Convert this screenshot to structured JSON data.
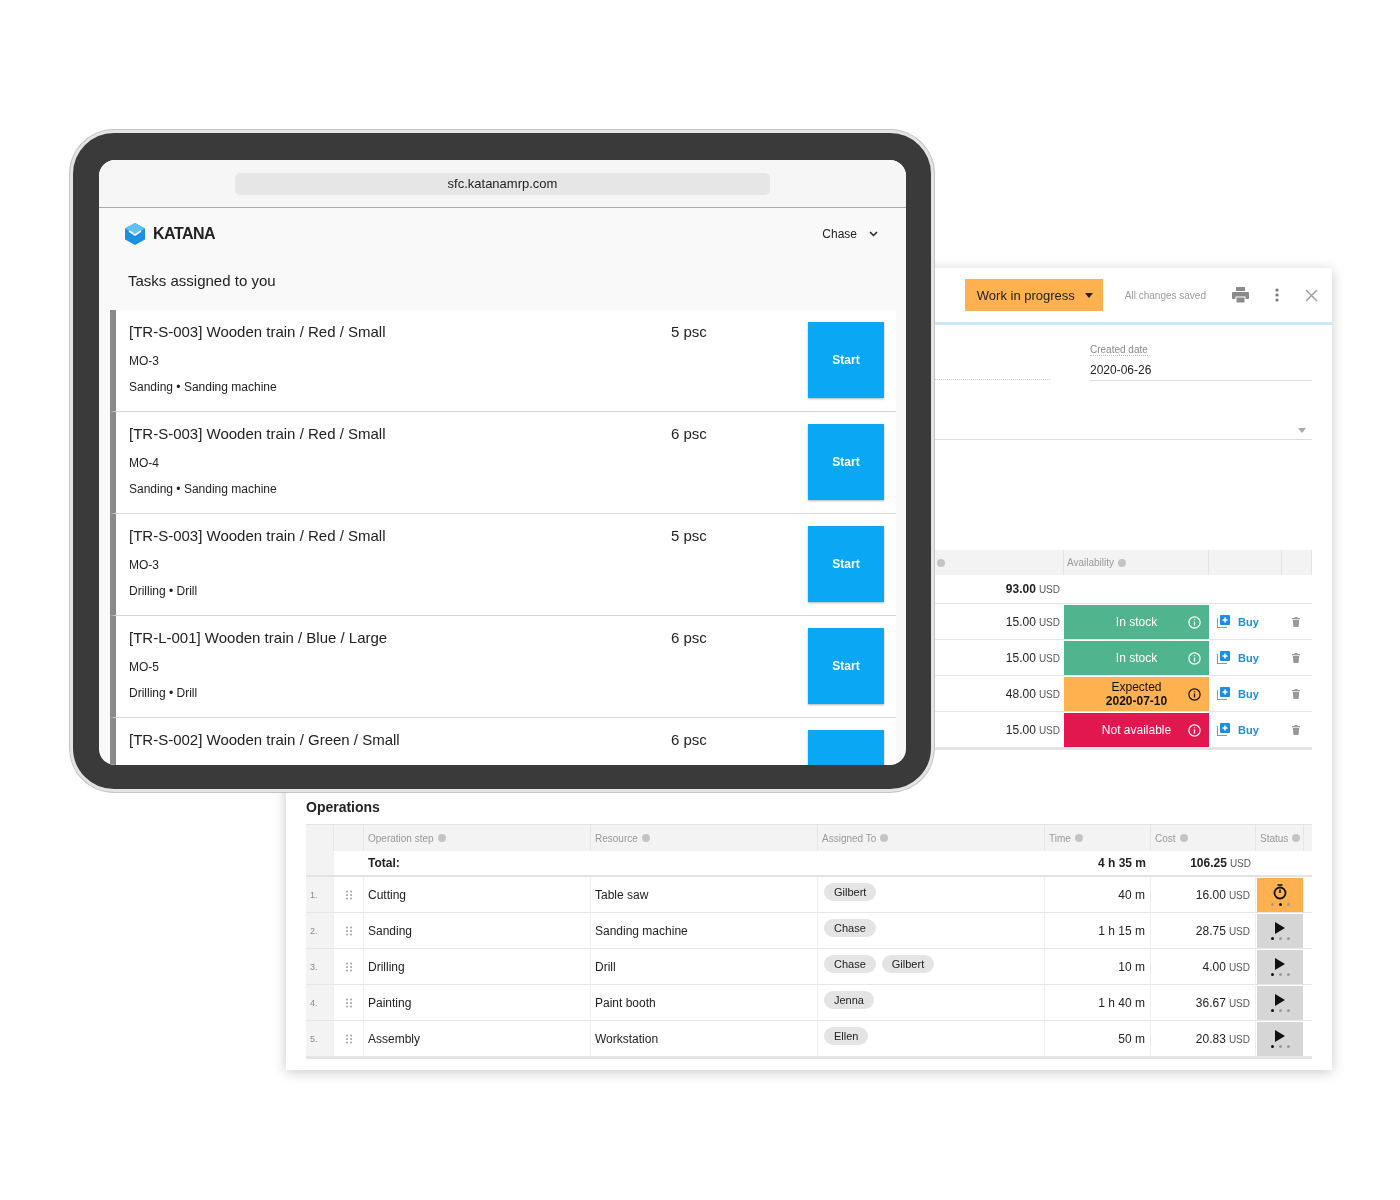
{
  "tablet": {
    "url": "sfc.katanamrp.com",
    "brand": "KATANA",
    "user": "Chase",
    "heading": "Tasks assigned to you",
    "tasks": [
      {
        "title": "[TR-S-003] Wooden train / Red / Small",
        "quantity": "5 psc",
        "order": "MO-3",
        "details": "Sanding • Sanding machine",
        "button": "Start"
      },
      {
        "title": "[TR-S-003] Wooden train / Red / Small",
        "quantity": "6 psc",
        "order": "MO-4",
        "details": "Sanding • Sanding machine",
        "button": "Start"
      },
      {
        "title": "[TR-S-003] Wooden train / Red / Small",
        "quantity": "5 psc",
        "order": "MO-3",
        "details": "Drilling • Drill",
        "button": "Start"
      },
      {
        "title": "[TR-L-001] Wooden train / Blue / Large",
        "quantity": "6 psc",
        "order": "MO-5",
        "details": "Drilling • Drill",
        "button": "Start"
      },
      {
        "title": "[TR-S-002] Wooden train / Green / Small",
        "quantity": "6 psc"
      }
    ]
  },
  "order": {
    "status": "Work in progress",
    "save_state": "All changes saved",
    "created_date": {
      "label": "Created date",
      "value": "2020-06-26"
    },
    "materials": {
      "availability_header": "Availability",
      "total": {
        "cost": "93.00",
        "currency": "USD"
      },
      "rows": [
        {
          "cost": "15.00",
          "currency": "USD",
          "availability": {
            "kind": "in_stock",
            "label": "In stock"
          },
          "buy": "Buy"
        },
        {
          "cost": "15.00",
          "currency": "USD",
          "availability": {
            "kind": "in_stock",
            "label": "In stock"
          },
          "buy": "Buy"
        },
        {
          "cost": "48.00",
          "currency": "USD",
          "availability": {
            "kind": "expected",
            "label": "Expected",
            "date": "2020-07-10"
          },
          "buy": "Buy"
        },
        {
          "cost": "15.00",
          "currency": "USD",
          "availability": {
            "kind": "not_available",
            "label": "Not available"
          },
          "buy": "Buy"
        }
      ]
    }
  },
  "operations": {
    "title": "Operations",
    "columns": [
      "Operation step",
      "Resource",
      "Assigned To",
      "Time",
      "Cost",
      "Status"
    ],
    "total": {
      "label": "Total:",
      "time": "4 h 35 m",
      "cost": "106.25",
      "currency": "USD"
    },
    "rows": [
      {
        "number": "1.",
        "step": "Cutting",
        "resource": "Table saw",
        "assigned": [
          "Gilbert"
        ],
        "time": "40 m",
        "cost": "16.00",
        "currency": "USD",
        "status": {
          "kind": "timer",
          "dots": [
            {
              "active": false
            },
            {
              "active": true
            },
            {
              "active": false
            }
          ]
        }
      },
      {
        "number": "2.",
        "step": "Sanding",
        "resource": "Sanding machine",
        "assigned": [
          "Chase"
        ],
        "time": "1 h 15 m",
        "cost": "28.75",
        "currency": "USD",
        "status": {
          "kind": "play",
          "dots": [
            {
              "active": true
            },
            {
              "active": false
            },
            {
              "active": false
            }
          ]
        }
      },
      {
        "number": "3.",
        "step": "Drilling",
        "resource": "Drill",
        "assigned": [
          "Chase",
          "Gilbert"
        ],
        "time": "10 m",
        "cost": "4.00",
        "currency": "USD",
        "status": {
          "kind": "play",
          "dots": [
            {
              "active": true
            },
            {
              "active": false
            },
            {
              "active": false
            }
          ]
        }
      },
      {
        "number": "4.",
        "step": "Painting",
        "resource": "Paint booth",
        "assigned": [
          "Jenna"
        ],
        "time": "1 h 40 m",
        "cost": "36.67",
        "currency": "USD",
        "status": {
          "kind": "play",
          "dots": [
            {
              "active": true
            },
            {
              "active": false
            },
            {
              "active": false
            }
          ]
        }
      },
      {
        "number": "5.",
        "step": "Assembly",
        "resource": "Workstation",
        "assigned": [
          "Ellen"
        ],
        "time": "50 m",
        "cost": "20.83",
        "currency": "USD",
        "status": {
          "kind": "play",
          "dots": [
            {
              "active": true
            },
            {
              "active": false
            },
            {
              "active": false
            }
          ]
        }
      }
    ]
  }
}
